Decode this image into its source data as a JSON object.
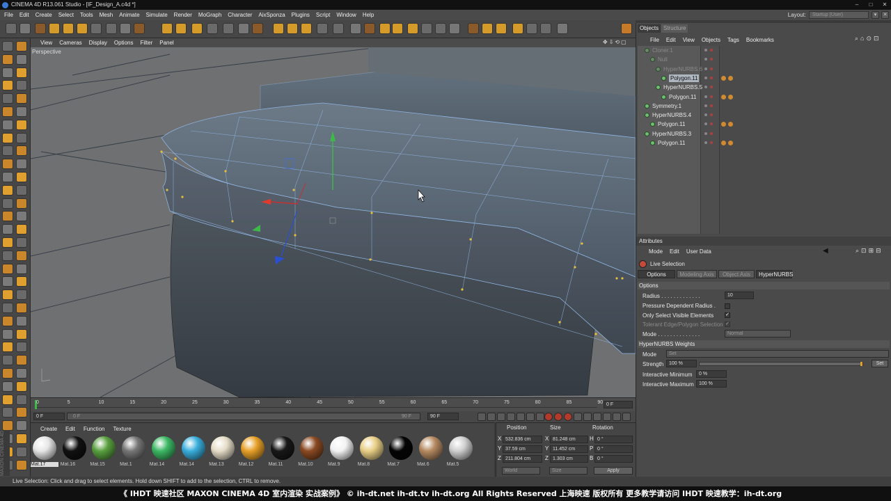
{
  "window": {
    "title": "CINEMA 4D R13.061 Studio - [IF_Design_A.c4d *]"
  },
  "menu": [
    "File",
    "Edit",
    "Create",
    "Select",
    "Tools",
    "Mesh",
    "Animate",
    "Simulate",
    "Render",
    "MoGraph",
    "Character",
    "AixSponza",
    "Plugins",
    "Script",
    "Window",
    "Help"
  ],
  "layout": {
    "label": "Layout:",
    "value": "Startup (User)"
  },
  "viewport": {
    "menu": [
      "View",
      "Cameras",
      "Display",
      "Options",
      "Filter",
      "Panel"
    ],
    "label": "Perspective"
  },
  "timeline": {
    "ticks": [
      "0",
      "5",
      "10",
      "15",
      "20",
      "25",
      "30",
      "35",
      "40",
      "45",
      "50",
      "55",
      "60",
      "65",
      "70",
      "75",
      "80",
      "85",
      "90"
    ],
    "current_frame": "0 F",
    "start_field": "0 F",
    "range_left": "0 F",
    "range_right": "90 F",
    "end_field": "90 F"
  },
  "materials": {
    "menu": [
      "Create",
      "Edit",
      "Function",
      "Texture"
    ],
    "items": [
      {
        "name": "Mat.17",
        "color": "#e6e6e6"
      },
      {
        "name": "Mat.16",
        "color": "#111111"
      },
      {
        "name": "Mat.15",
        "color": "#5aa040"
      },
      {
        "name": "Mat.1",
        "color": "#777777"
      },
      {
        "name": "Mat.14",
        "color": "#3cb864"
      },
      {
        "name": "Mat.14",
        "color": "#3aaedc"
      },
      {
        "name": "Mat.13",
        "color": "#e6ddc8"
      },
      {
        "name": "Mat.12",
        "color": "#e7a028"
      },
      {
        "name": "Mat.11",
        "color": "#181818"
      },
      {
        "name": "Mat.10",
        "color": "#8a4a22"
      },
      {
        "name": "Mat.9",
        "color": "#f2f2f2"
      },
      {
        "name": "Mat.8",
        "color": "#e8cf86"
      },
      {
        "name": "Mat.7",
        "color": "#050505"
      },
      {
        "name": "Mat.6",
        "color": "#b68a62"
      },
      {
        "name": "Mat.5",
        "color": "#cfcfcf"
      }
    ]
  },
  "coords": {
    "headers": [
      "Position",
      "Size",
      "Rotation"
    ],
    "rows": [
      {
        "axis": "X",
        "pos": "532.836 cm",
        "size": "81.248 cm",
        "rot_label": "H",
        "rot": "0 °"
      },
      {
        "axis": "Y",
        "pos": "37.59 cm",
        "size": "11.452 cm",
        "rot_label": "P",
        "rot": "0 °"
      },
      {
        "axis": "Z",
        "pos": "211.804 cm",
        "size": "1.303 cm",
        "rot_label": "B",
        "rot": "0 °"
      }
    ],
    "mode": "World",
    "size_mode": "Size",
    "apply": "Apply"
  },
  "objects": {
    "tabs": [
      "Objects",
      "Structure"
    ],
    "menu": [
      "File",
      "Edit",
      "View",
      "Objects",
      "Tags",
      "Bookmarks"
    ],
    "rows": [
      {
        "name": "Cloner.1",
        "dim": true,
        "indent": 0
      },
      {
        "name": "Null",
        "dim": true,
        "indent": 1
      },
      {
        "name": "HyperNURBS.6",
        "dim": true,
        "indent": 2
      },
      {
        "name": "Polygon.11",
        "dim": false,
        "indent": 3,
        "highlight": true,
        "tags": true
      },
      {
        "name": "HyperNURBS.5",
        "dim": false,
        "indent": 2
      },
      {
        "name": "Polygon.11",
        "dim": false,
        "indent": 3,
        "tags": true
      },
      {
        "name": "Symmetry.1",
        "dim": false,
        "indent": 0
      },
      {
        "name": "HyperNURBS.4",
        "dim": false,
        "indent": 0
      },
      {
        "name": "Polygon.11",
        "dim": false,
        "indent": 1,
        "tags": true
      },
      {
        "name": "HyperNURBS.3",
        "dim": false,
        "indent": 0
      },
      {
        "name": "Polygon.11",
        "dim": false,
        "indent": 1,
        "tags": true
      }
    ]
  },
  "attributes": {
    "title": "Attributes",
    "menu": [
      "Mode",
      "Edit",
      "User Data"
    ],
    "tool": "Live Selection",
    "tabs": [
      "Options",
      "Modeling Axis",
      "Object Axis",
      "HyperNURBS"
    ],
    "section_options": "Options",
    "radius_label": "Radius . . . . . . . . . . . . .",
    "radius_value": "10",
    "pressure_label": "Pressure Dependent Radius .",
    "visible_label": "Only Select Visible Elements",
    "tolerant_label": "Tolerant Edge/Polygon Selection",
    "mode_label": "Mode . . . . . . . . . . . . . .",
    "mode_value": "Normal",
    "section_weights": "HyperNURBS Weights",
    "w_mode_label": "Mode",
    "w_mode_value": "Set",
    "strength_label": "Strength",
    "strength_value": "100 %",
    "strength_set": "Set",
    "imin_label": "Interactive Minimum",
    "imin_value": "0 %",
    "imax_label": "Interactive Maximum",
    "imax_value": "100 %"
  },
  "status": "Live Selection: Click and drag to select elements. Hold down SHIFT to add to the selection, CTRL to remove.",
  "banner": "《 IHDT 映速社区 MAXON CINEMA 4D 室内渲染 实战案例》  © ih-dt.net ih-dt.tv  ih-dt.org  All Rights Reserved 上海映速 版权所有    更多教学请访问 IHDT 映速教学：ih-dt.org",
  "logo": "MAXON CINEMA 4D"
}
